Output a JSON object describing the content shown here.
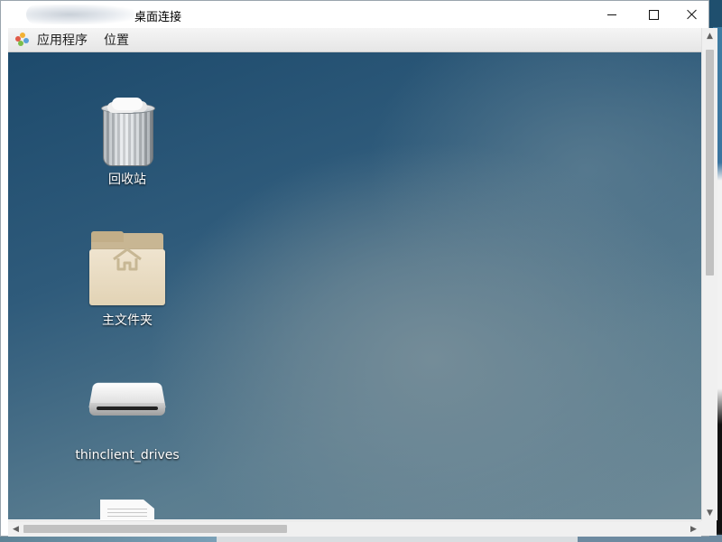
{
  "window": {
    "title": "桌面连接",
    "minimize_label": "Minimize",
    "maximize_label": "Maximize",
    "close_label": "Close"
  },
  "menubar": {
    "applications": "应用程序",
    "places": "位置"
  },
  "desktop": {
    "icons": [
      {
        "label": "回收站",
        "icon": "trash-icon"
      },
      {
        "label": "主文件夹",
        "icon": "home-folder-icon"
      },
      {
        "label": "thinclient_drives",
        "icon": "drive-icon"
      },
      {
        "label": "",
        "icon": "document-icon"
      }
    ]
  },
  "colors": {
    "desktop_top": "#1d4a6c",
    "desktop_center": "#748c98",
    "menubar_bg": "#eeeeee",
    "scrollbar_thumb": "#c1c1c1"
  }
}
